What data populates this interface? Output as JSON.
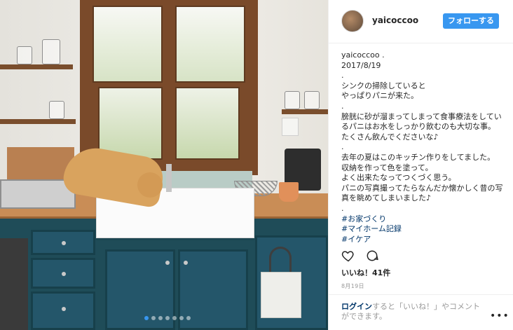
{
  "header": {
    "username": "yaicoccoo",
    "follow_label": "フォローする"
  },
  "caption": {
    "lines": [
      "yaicoccoo .",
      "2017/8/19",
      ".",
      "シンクの掃除していると",
      "やっぱりパニが来た。",
      ".",
      "膀胱に砂が溜まってしまって食事療法をしているパニはお水をしっかり飲むのも大切な事。",
      "たくさん飲んでくださいな♪",
      ".",
      "去年の夏はこのキッチン作りをしてました。",
      "収納を作って色を塗って。",
      "よく出来たなってつくづく思う。",
      "パニの写真撮ってたらなんだか懐かしく昔の写真を眺めてしまいました♪",
      "."
    ],
    "hashtags": [
      "#お家づくり",
      "#マイホーム記録",
      "#イケア"
    ]
  },
  "engagement": {
    "likes_text": "いいね！41件",
    "date_text": "8月19日"
  },
  "footer": {
    "login_link": "ログイン",
    "login_rest": "すると「いいね！」やコメントができます。",
    "more_label": "•••"
  },
  "carousel": {
    "total": 7,
    "active_index": 0
  },
  "colors": {
    "accent": "#3897f0",
    "link": "#003569",
    "muted": "#999999"
  },
  "icons": [
    "heart-icon",
    "comment-icon",
    "more-options-icon"
  ]
}
